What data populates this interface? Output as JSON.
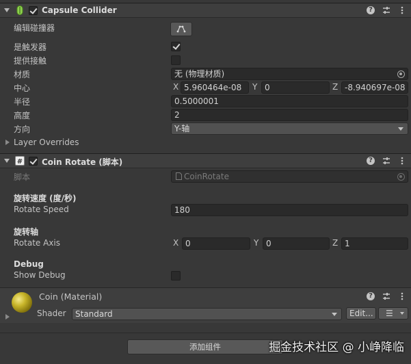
{
  "capsule": {
    "title": "Capsule Collider",
    "edit_collider_label": "编辑碰撞器",
    "is_trigger_label": "是触发器",
    "is_trigger": true,
    "provides_contacts_label": "提供接触",
    "provides_contacts": false,
    "material_label": "材质",
    "material_value": "无 (物理材质)",
    "center_label": "中心",
    "center": {
      "x_label": "X",
      "x": "5.960464e-08",
      "y_label": "Y",
      "y": "0",
      "z_label": "Z",
      "z": "-8.940697e-08"
    },
    "radius_label": "半径",
    "radius": "0.5000001",
    "height_label": "高度",
    "height": "2",
    "direction_label": "方向",
    "direction": "Y-轴",
    "layer_overrides_label": "Layer Overrides"
  },
  "coin_rotate": {
    "title": "Coin Rotate (脚本)",
    "script_label": "脚本",
    "script_value": "CoinRotate",
    "speed_header": "旋转速度 (度/秒)",
    "speed_label": "Rotate Speed",
    "speed_value": "180",
    "axis_header": "旋转轴",
    "axis_label": "Rotate Axis",
    "axis": {
      "x_label": "X",
      "x": "0",
      "y_label": "Y",
      "y": "0",
      "z_label": "Z",
      "z": "1"
    },
    "debug_header": "Debug",
    "debug_label": "Show Debug",
    "show_debug": false
  },
  "material": {
    "title": "Coin (Material)",
    "shader_label": "Shader",
    "shader_value": "Standard",
    "edit_label": "Edit...",
    "list_label": "☰"
  },
  "footer": {
    "add_component_label": "添加组件",
    "watermark": "掘金技术社区 @ 小峥降临"
  },
  "colors": {
    "background": "#383838",
    "header": "#3e3e3e",
    "field": "#2a2a2a",
    "collider_icon": "#8fd14f",
    "material_sphere": "#c8b52a"
  }
}
